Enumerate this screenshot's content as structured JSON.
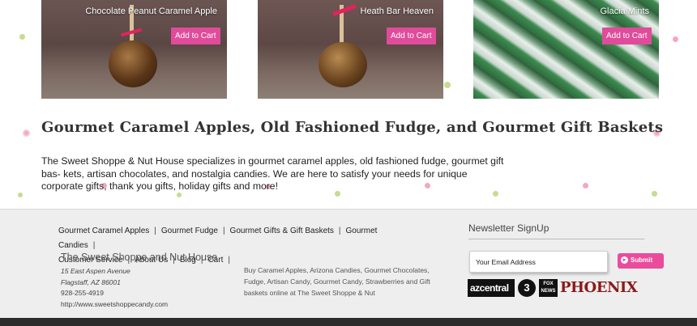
{
  "products": [
    {
      "name": "Chocolate Peanut Caramel Apple",
      "cart_label": "Add to Cart"
    },
    {
      "name": "Heath Bar Heaven",
      "cart_label": "Add to Cart"
    },
    {
      "name": "Glacia Mints",
      "cart_label": "Add to Cart"
    }
  ],
  "main": {
    "heading": "Gourmet Caramel Apples, Old Fashioned Fudge, and Gourmet Gift Baskets",
    "intro": "The Sweet Shoppe & Nut House specializes in gourmet caramel apples, old fashioned fudge, gourmet gift bas- kets, artisan chocolates, and nostalgia candies. We are here to satisfy your needs for unique corporate gifts, thank you gifts, holiday gifts and more!"
  },
  "footer": {
    "nav": [
      "Gourmet Caramel Apples",
      "Gourmet Fudge",
      "Gourmet Gifts & Gift Baskets",
      "Gourmet Candies",
      "Customer Service",
      "About Us",
      "Blog",
      "Cart"
    ],
    "business_name": "The Sweet Shoppe and Nut House",
    "address_line1": "15 East Aspen Avenue",
    "address_line2": "Flagstaff, AZ 86001",
    "phone": "928-255-4919",
    "website": "http://www.sweetshoppecandy.com",
    "seo_text": "Buy Caramel Apples, Arizona Candies, Gourmet Chocolates, Fudge, Artisan Candy, Gourmet Candy, Strawberries and Gift baskets online at The Sweet Shoppe & Nut",
    "newsletter": {
      "title": "Newsletter SignUp",
      "input_value": "Your Email Address",
      "submit_label": "Submit"
    },
    "media_logos": [
      "azcentral",
      "3",
      "FOX NEWS",
      "PHOENIX"
    ]
  },
  "colors": {
    "accent": "#e04b9b",
    "dot_green": "#c6dc8f",
    "dot_pink": "#f2a7c6"
  }
}
